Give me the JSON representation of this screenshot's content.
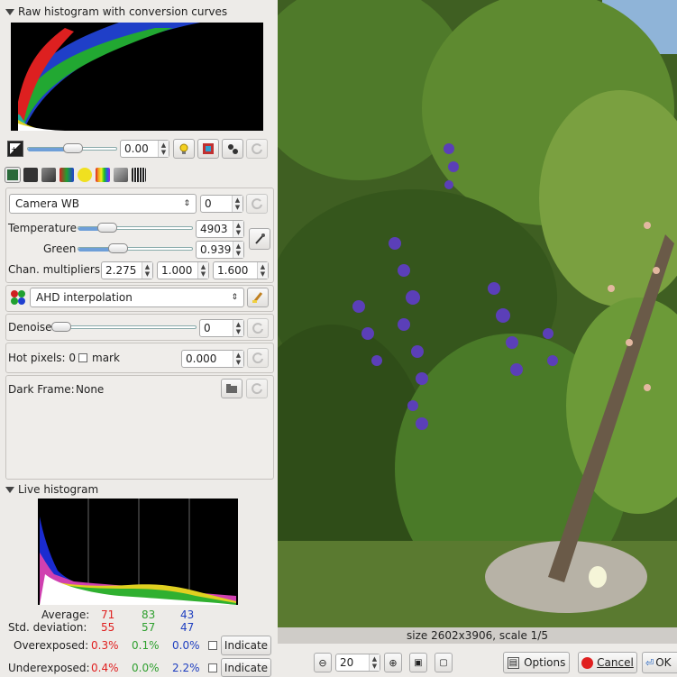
{
  "raw_histogram": {
    "title": "Raw histogram with conversion curves"
  },
  "exposure": {
    "value": "0.00"
  },
  "white_balance": {
    "preset": "Camera WB",
    "fine_tune": "0",
    "temperature_label": "Temperature",
    "temperature_value": "4903",
    "green_label": "Green",
    "green_value": "0.939",
    "chan_label": "Chan. multipliers:",
    "chan_r": "2.275",
    "chan_g": "1.000",
    "chan_b": "1.600"
  },
  "interpolation": {
    "value": "AHD interpolation"
  },
  "denoise": {
    "label": "Denoise",
    "value": "0"
  },
  "hot_pixels": {
    "label": "Hot pixels: 0",
    "mark_label": "mark",
    "value": "0.000"
  },
  "dark_frame": {
    "label": "Dark Frame:",
    "value": "None"
  },
  "live_histogram": {
    "title": "Live histogram",
    "average_label": "Average:",
    "average_r": "71",
    "average_g": "83",
    "average_b": "43",
    "std_label": "Std. deviation:",
    "std_r": "55",
    "std_g": "57",
    "std_b": "47",
    "over_label": "Overexposed:",
    "over_r": "0.3%",
    "over_g": "0.1%",
    "over_b": "0.0%",
    "under_label": "Underexposed:",
    "under_r": "0.4%",
    "under_g": "0.0%",
    "under_b": "2.2%",
    "indicate_label": "Indicate"
  },
  "status": {
    "text": "size 2602x3906, scale 1/5"
  },
  "bottom": {
    "zoom_value": "20",
    "options_label": "Options",
    "cancel_label": "Cancel",
    "ok_label": "OK"
  },
  "colors": {
    "red_text": "#e02020",
    "green_text": "#30a030",
    "blue_text": "#2040c0",
    "slider_fill": "#6e9fd8"
  }
}
